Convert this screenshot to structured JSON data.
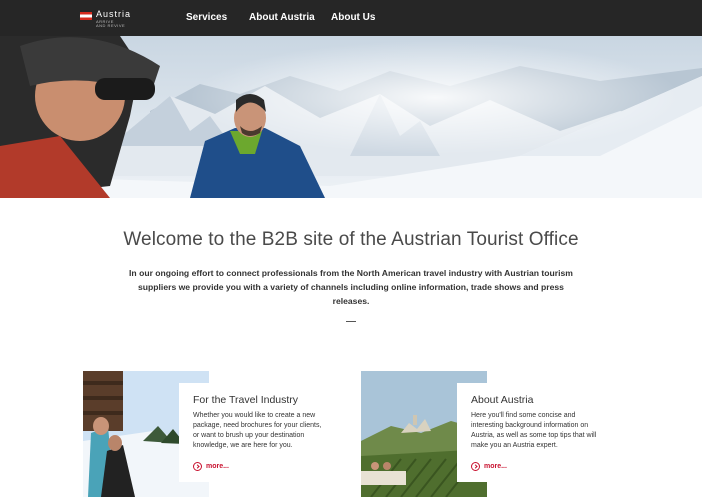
{
  "header": {
    "logo": {
      "name": "Austria",
      "tagline_line1": "ARRIVE",
      "tagline_line2": "AND REVIVE"
    },
    "nav": [
      "Services",
      "About Austria",
      "About Us"
    ]
  },
  "hero": {
    "image": "skiers-on-snowy-mountain"
  },
  "welcome": {
    "title": "Welcome to the B2B site of the Austrian Tourist Office",
    "text": "In our ongoing effort to connect professionals from the North American travel industry with Austrian tourism suppliers we provide you with a variety of channels including online information, trade shows and press releases."
  },
  "cards": [
    {
      "title": "For the Travel Industry",
      "text": "Whether you would like to create a new package, need brochures for your clients, or want to brush up your destination knowledge, we are here for you.",
      "more": "more..."
    },
    {
      "title": "About Austria",
      "text": "Here you'll find some concise and interesting background information on Austria, as well as some top tips that will make you an Austria expert.",
      "more": "more..."
    }
  ],
  "colors": {
    "header_bg": "#262626",
    "accent": "#c8102e"
  }
}
